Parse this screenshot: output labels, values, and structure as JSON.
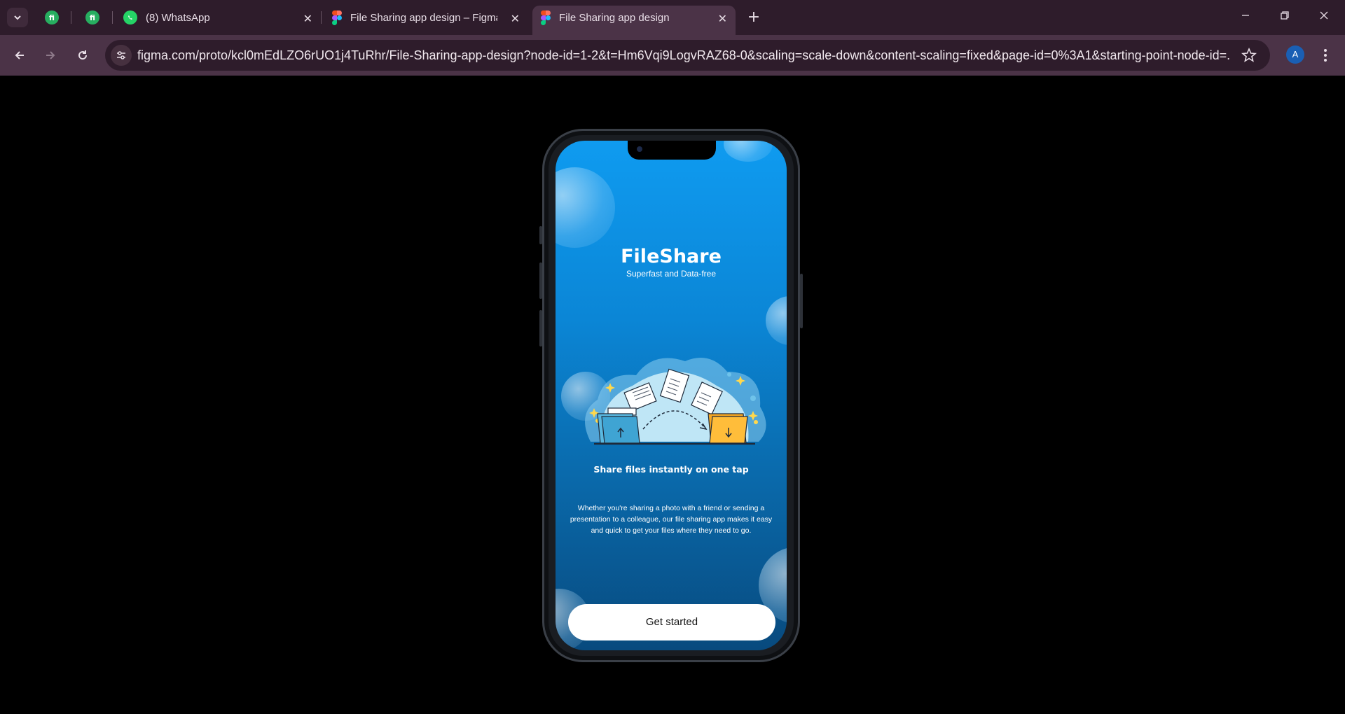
{
  "browser": {
    "tabs": [
      {
        "title": "(8) WhatsApp",
        "icon": "whatsapp-icon"
      },
      {
        "title": "File Sharing app design – Figma",
        "icon": "figma-icon"
      },
      {
        "title": "File Sharing app design",
        "icon": "figma-icon",
        "active": true
      }
    ],
    "pinned_tabs": [
      {
        "icon": "fi-app-icon",
        "glyph": "fi"
      },
      {
        "icon": "fi-app-icon",
        "glyph": "fi"
      }
    ],
    "url": "figma.com/proto/kcl0mEdLZO6rUO1j4TuRhr/File-Sharing-app-design?node-id=1-2&t=Hm6Vqi9LogvRAZ68-0&scaling=scale-down&content-scaling=fixed&page-id=0%3A1&starting-point-node-id=...",
    "profile_initial": "A",
    "colors": {
      "tabstrip": "#2e1c2b",
      "toolbar": "#4b3347",
      "avatar": "#1a5fb4"
    }
  },
  "app": {
    "brand_title": "FileShare",
    "brand_subtitle": "Superfast and Data-free",
    "headline": "Share files instantly on one tap",
    "description": "Whether you're sharing a photo with a friend or sending a presentation to a colleague, our file sharing app makes it easy and quick to get your files where they need to go.",
    "cta_label": "Get started",
    "colors": {
      "gradient_top": "#0f9bf0",
      "gradient_bottom": "#084a7e",
      "button": "#ffffff",
      "folder_left": "#5ab8e0",
      "folder_right": "#f5a623"
    }
  }
}
